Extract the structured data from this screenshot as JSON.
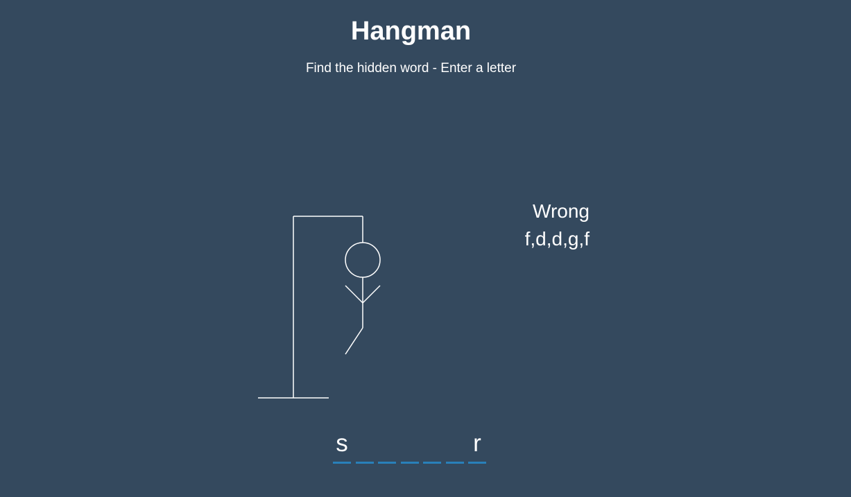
{
  "title": "Hangman",
  "subtitle": "Find the hidden word - Enter a letter",
  "wrong": {
    "label": "Wrong",
    "letters_text": "f,d,d,g,f"
  },
  "word": {
    "letters": [
      "s",
      "",
      "",
      "",
      "",
      "",
      "r"
    ]
  },
  "colors": {
    "background": "#34495e",
    "text": "#ffffff",
    "slot_underline": "#2980b9",
    "figure_stroke": "#ffffff"
  },
  "hangman_parts_visible": [
    "base",
    "pole",
    "beam",
    "rope",
    "head",
    "body",
    "left-arm",
    "right-arm",
    "left-leg"
  ]
}
